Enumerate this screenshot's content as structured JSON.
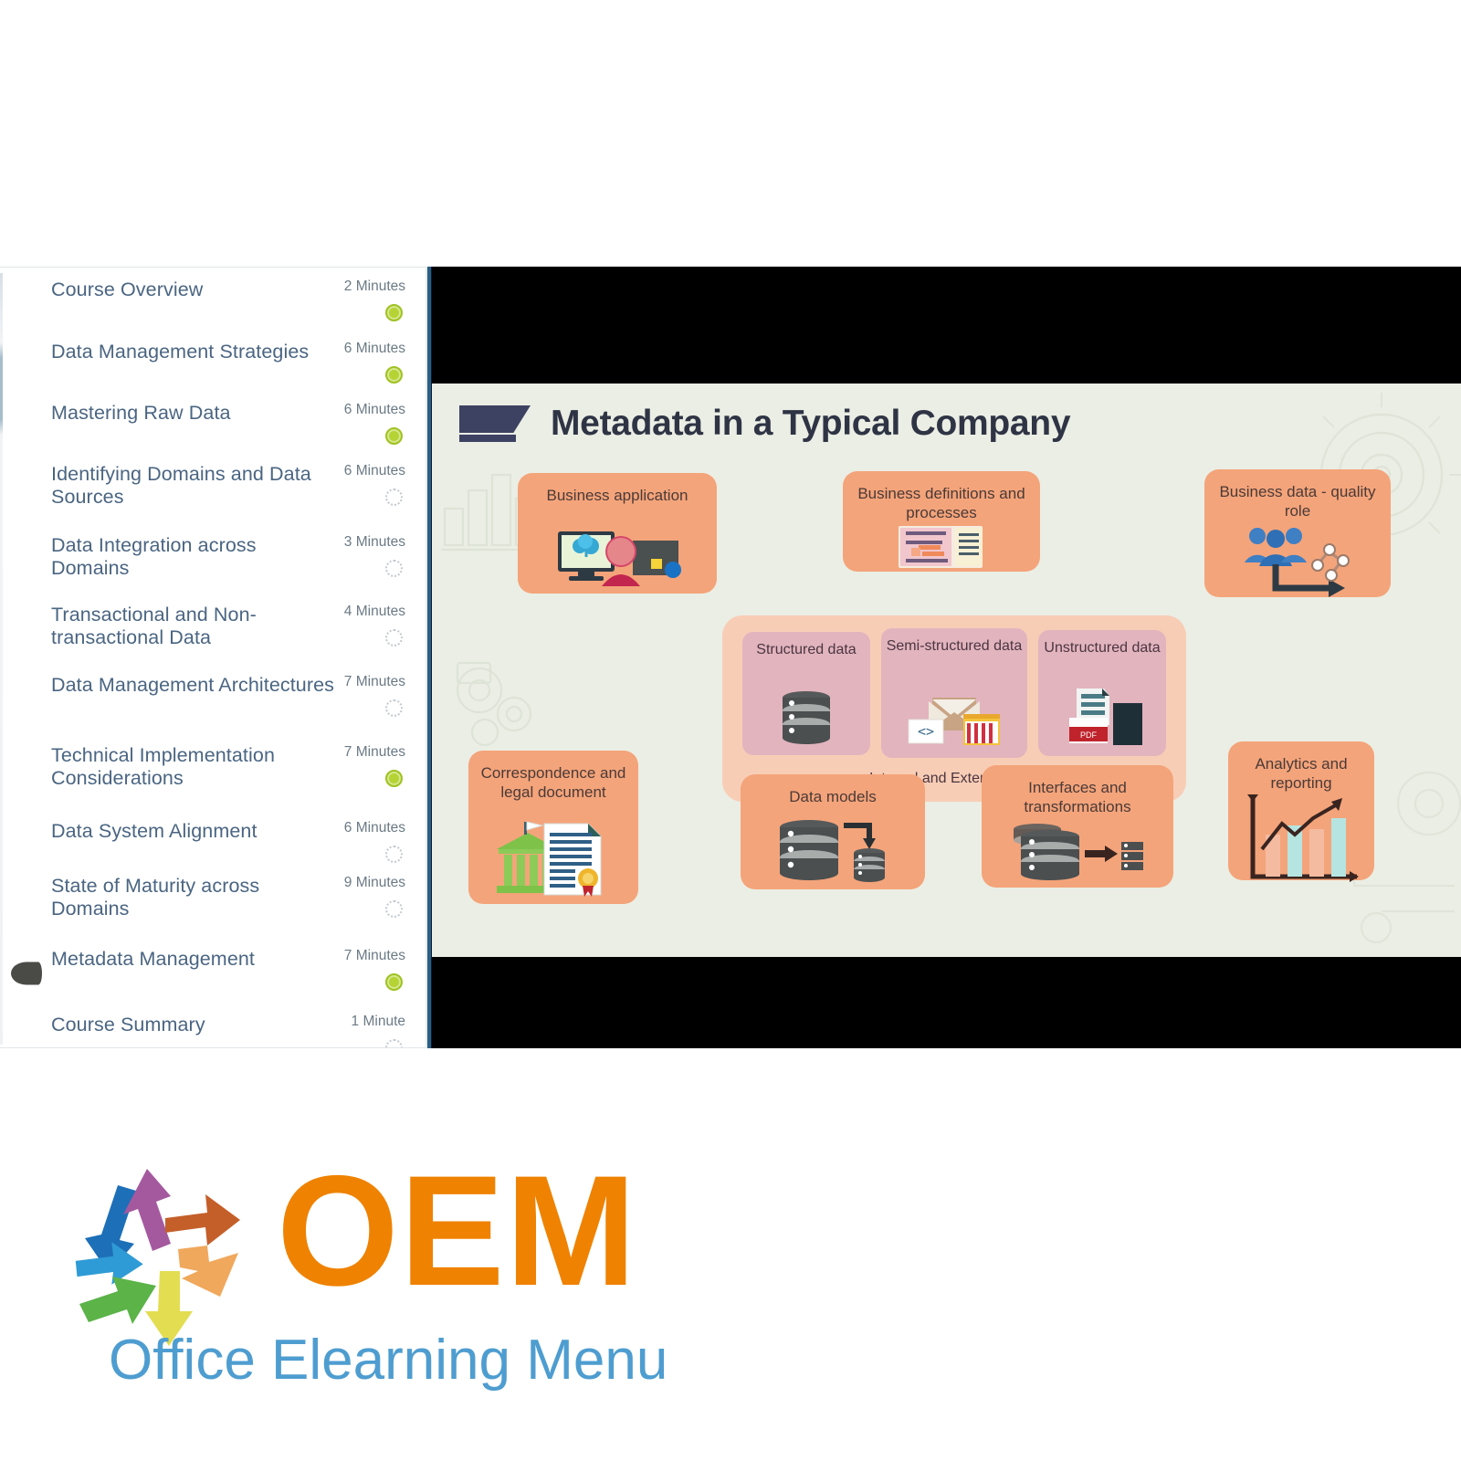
{
  "sidebar": {
    "name": "course-outline",
    "items": [
      {
        "label": "Course Overview",
        "duration": "2 Minutes",
        "status": "done",
        "current": false
      },
      {
        "label": "Data Management Strategies",
        "duration": "6 Minutes",
        "status": "done",
        "current": false
      },
      {
        "label": "Mastering Raw Data",
        "duration": "6 Minutes",
        "status": "done",
        "current": false
      },
      {
        "label": "Identifying Domains and Data Sources",
        "duration": "6 Minutes",
        "status": "todo",
        "current": false
      },
      {
        "label": "Data Integration across Domains",
        "duration": "3 Minutes",
        "status": "todo",
        "current": false
      },
      {
        "label": "Transactional and Non-transactional Data",
        "duration": "4 Minutes",
        "status": "todo",
        "current": false
      },
      {
        "label": "Data Management Architectures",
        "duration": "7 Minutes",
        "status": "todo",
        "current": false
      },
      {
        "label": "Technical Implementation Considerations",
        "duration": "7 Minutes",
        "status": "done",
        "current": false
      },
      {
        "label": "Data System Alignment",
        "duration": "6 Minutes",
        "status": "todo",
        "current": false
      },
      {
        "label": "State of Maturity across Domains",
        "duration": "9 Minutes",
        "status": "todo",
        "current": false
      },
      {
        "label": "Metadata Management",
        "duration": "7 Minutes",
        "status": "done",
        "current": true
      },
      {
        "label": "Course Summary",
        "duration": "1 Minute",
        "status": "todo",
        "current": false
      }
    ]
  },
  "slide": {
    "title": "Metadata in a Typical Company",
    "cards": [
      {
        "id": "business-application",
        "label": "Business application",
        "icon": "monitor-person-icon"
      },
      {
        "id": "business-definitions",
        "label": "Business definitions and processes",
        "icon": "document-forms-icon"
      },
      {
        "id": "business-data-quality-role",
        "label": "Business data - quality role",
        "icon": "people-network-icon"
      },
      {
        "id": "correspondence-legal",
        "label": "Correspondence and legal document",
        "icon": "bank-certificate-icon"
      },
      {
        "id": "data-models",
        "label": "Data models",
        "icon": "database-arrow-icon"
      },
      {
        "id": "interfaces-transformations",
        "label": "Interfaces and transformations",
        "icon": "database-transfer-icon"
      },
      {
        "id": "analytics-reporting",
        "label": "Analytics and reporting",
        "icon": "bar-chart-trend-icon"
      }
    ],
    "data_types": {
      "caption": "Internal and External Data",
      "items": [
        {
          "id": "structured-data",
          "label": "Structured data",
          "icon": "database-stack-icon"
        },
        {
          "id": "semi-structured-data",
          "label": "Semi-structured data",
          "icon": "xml-envelope-icon"
        },
        {
          "id": "unstructured-data",
          "label": "Unstructured data",
          "icon": "pdf-documents-icon"
        }
      ]
    },
    "colors": {
      "background": "#ebeee4",
      "card": "#f4a47a",
      "group": "#f8cdb6",
      "subcard": "#e2b4be",
      "title": "#2f3445"
    }
  },
  "logo": {
    "wordmark": "OEM",
    "tagline": "Office Elearning Menu",
    "colors": {
      "wordmark": "#ef8200",
      "tagline": "#4e9dd0"
    }
  }
}
